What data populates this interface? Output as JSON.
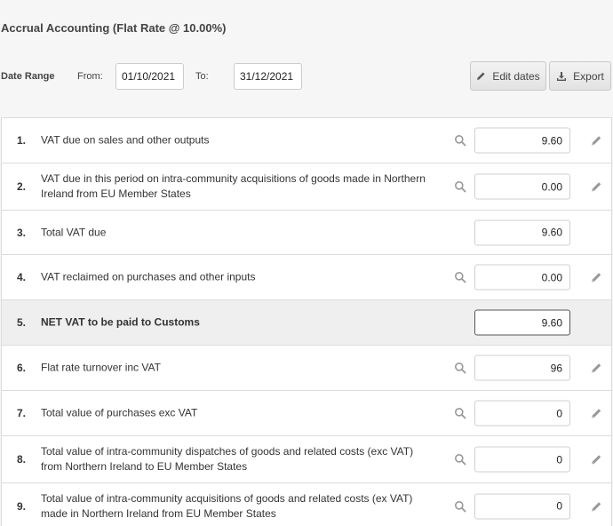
{
  "page": {
    "title": "Accrual Accounting (Flat Rate @ 10.00%)"
  },
  "date_bar": {
    "range_label": "Date Range",
    "from_label": "From:",
    "from_value": "01/10/2021",
    "to_label": "To:",
    "to_value": "31/12/2021",
    "edit_label": "Edit dates",
    "export_label": "Export"
  },
  "icons": {
    "edit_button": "pencil-icon",
    "export_button": "download-icon",
    "row_lookup": "search-icon",
    "row_edit": "pencil-icon"
  },
  "colors": {
    "highlight_row": "#efefef",
    "border": "#dcdcdc"
  },
  "rows": [
    {
      "num": "1.",
      "label": "VAT due on sales and other outputs",
      "value": "9.60",
      "lookup": true,
      "editable": true
    },
    {
      "num": "2.",
      "label": "VAT due in this period on intra-community acquisitions of goods made in Northern Ireland from EU Member States",
      "value": "0.00",
      "lookup": true,
      "editable": true
    },
    {
      "num": "3.",
      "label": "Total VAT due",
      "value": "9.60",
      "lookup": false,
      "editable": false
    },
    {
      "num": "4.",
      "label": "VAT reclaimed on purchases and other inputs",
      "value": "0.00",
      "lookup": true,
      "editable": true
    },
    {
      "num": "5.",
      "label": "NET VAT to be paid to Customs",
      "value": "9.60",
      "lookup": false,
      "editable": false,
      "highlight": true
    },
    {
      "num": "6.",
      "label": "Flat rate turnover inc VAT",
      "value": "96",
      "lookup": true,
      "editable": true
    },
    {
      "num": "7.",
      "label": "Total value of purchases exc VAT",
      "value": "0",
      "lookup": true,
      "editable": true
    },
    {
      "num": "8.",
      "label": "Total value of intra-community dispatches of goods and related costs (exc VAT) from Northern Ireland to EU Member States",
      "value": "0",
      "lookup": true,
      "editable": true
    },
    {
      "num": "9.",
      "label": "Total value of intra-community acquisitions of goods and related costs (ex VAT) made in Northern Ireland from EU Member States",
      "value": "0",
      "lookup": true,
      "editable": true
    }
  ]
}
